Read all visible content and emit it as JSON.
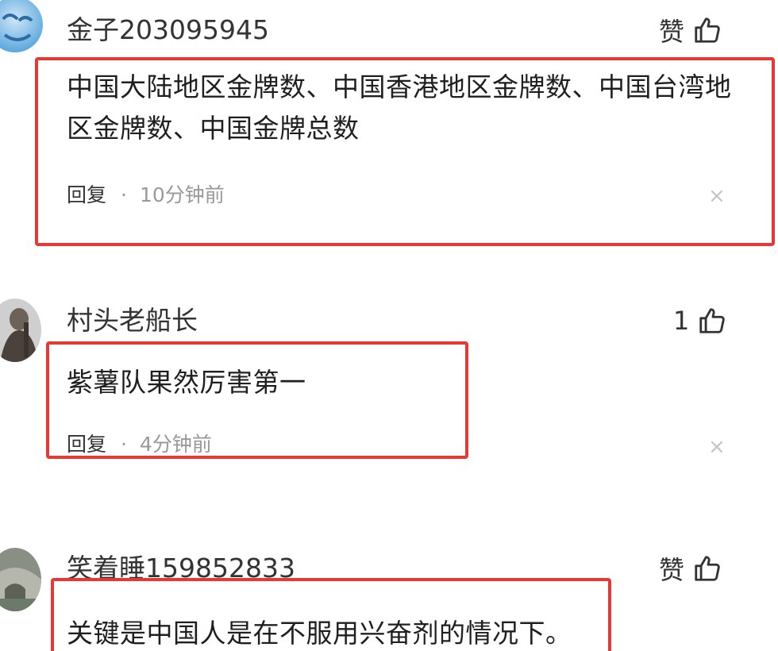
{
  "comments": [
    {
      "username": "金子203095945",
      "like_label": "赞",
      "text": "中国大陆地区金牌数、中国香港地区金牌数、中国台湾地区金牌数、中国金牌总数",
      "reply_label": "回复",
      "separator": "·",
      "time": "10分钟前",
      "dismiss": "×"
    },
    {
      "username": "村头老船长",
      "like_label": "1",
      "text": "紫薯队果然厉害第一",
      "reply_label": "回复",
      "separator": "·",
      "time": "4分钟前",
      "dismiss": "×"
    },
    {
      "username": "笑着睡159852833",
      "like_label": "赞",
      "text": "关键是中国人是在不服用兴奋剂的情况下。"
    }
  ],
  "icons": {
    "like": "thumbs-up-icon",
    "dismiss": "close-icon"
  },
  "colors": {
    "highlight": "#e53935",
    "meta_gray": "#999999",
    "text": "#1f1f1f"
  }
}
